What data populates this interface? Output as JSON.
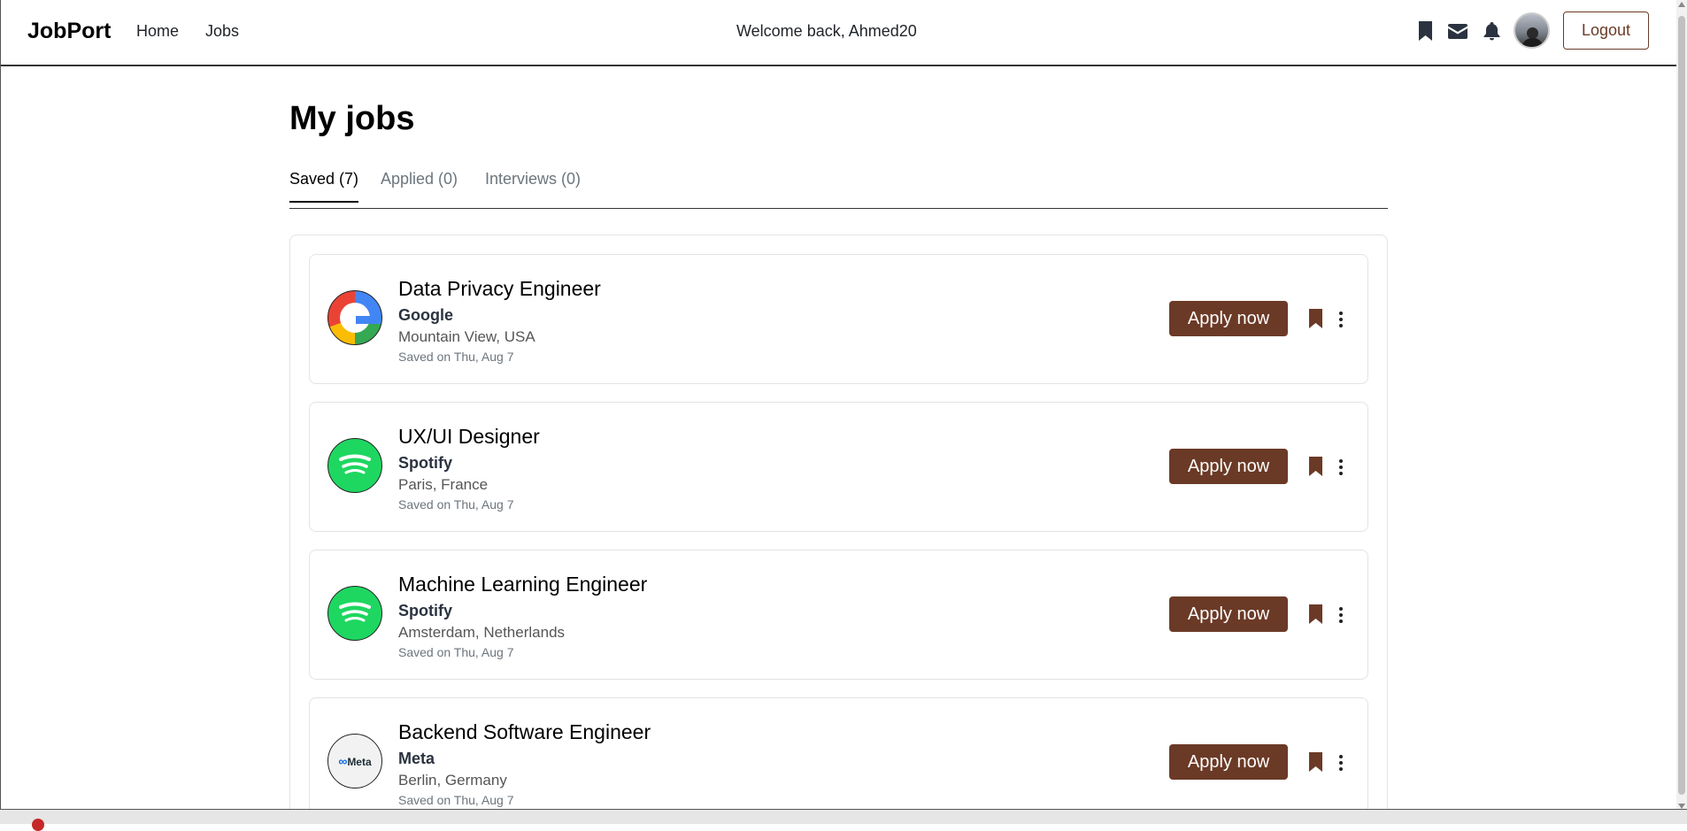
{
  "navbar": {
    "brand": "JobPort",
    "links": {
      "home": "Home",
      "jobs": "Jobs"
    },
    "welcome": "Welcome back, Ahmed20",
    "icons": [
      "bookmark-icon",
      "mail-icon",
      "bell-icon"
    ],
    "logout_label": "Logout"
  },
  "page": {
    "title": "My jobs",
    "tabs": [
      {
        "label": "Saved (7)",
        "active": true
      },
      {
        "label": "Applied (0)",
        "active": false
      },
      {
        "label": "Interviews (0)",
        "active": false
      }
    ]
  },
  "jobs": [
    {
      "title": "Data Privacy Engineer",
      "company": "Google",
      "location": "Mountain View, USA",
      "saved": "Saved on Thu, Aug 7",
      "logo": "google-logo",
      "apply_label": "Apply now"
    },
    {
      "title": "UX/UI Designer",
      "company": "Spotify",
      "location": "Paris, France",
      "saved": "Saved on Thu, Aug 7",
      "logo": "spotify-logo",
      "apply_label": "Apply now"
    },
    {
      "title": "Machine Learning Engineer",
      "company": "Spotify",
      "location": "Amsterdam, Netherlands",
      "saved": "Saved on Thu, Aug 7",
      "logo": "spotify-logo",
      "apply_label": "Apply now"
    },
    {
      "title": "Backend Software Engineer",
      "company": "Meta",
      "location": "Berlin, Germany",
      "saved": "Saved on Thu, Aug 7",
      "logo": "meta-logo",
      "apply_label": "Apply now",
      "logo_text": "Meta"
    }
  ],
  "colors": {
    "accent": "#6b3a26",
    "spotify": "#1ed760",
    "text": "#212529"
  }
}
